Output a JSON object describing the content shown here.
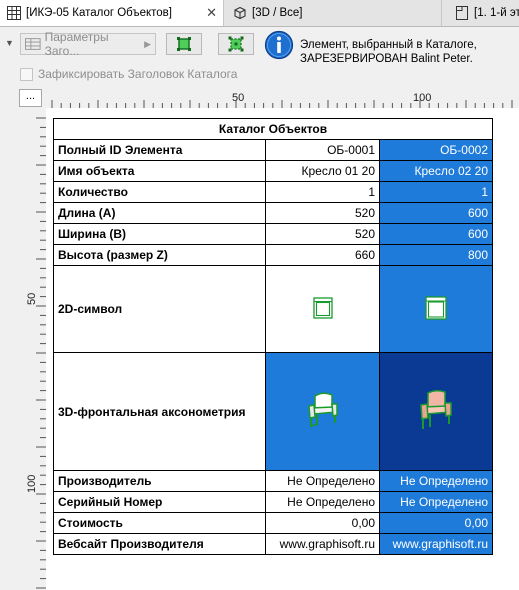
{
  "tabs": [
    {
      "label": "[ИКЭ-05 Каталог Объектов]",
      "active": true,
      "icon": "table-icon"
    },
    {
      "label": "[3D / Все]",
      "icon": "cube-icon"
    },
    {
      "label": "[1. 1-й эт",
      "icon": "floorplan-icon"
    }
  ],
  "toolbar": {
    "params_label": "Параметры Заго...",
    "info_message": "Элемент, выбранный в Каталоге, ЗАРЕЗЕРВИРОВАН Balint Peter.",
    "fix_label": "Зафиксировать Заголовок Каталога",
    "corner_label": "..."
  },
  "ruler": {
    "h_labels": [
      "50",
      "100"
    ],
    "v_labels": [
      "50",
      "100"
    ]
  },
  "catalog": {
    "title": "Каталог Объектов",
    "rows": [
      {
        "label": "Полный ID Элемента",
        "v1": "ОБ-0001",
        "v2": "ОБ-0002"
      },
      {
        "label": "Имя объекта",
        "v1": "Кресло 01 20",
        "v2": "Кресло 02 20"
      },
      {
        "label": "Количество",
        "v1": "1",
        "v2": "1"
      },
      {
        "label": "Длина (А)",
        "v1": "520",
        "v2": "600"
      },
      {
        "label": "Ширина (В)",
        "v1": "520",
        "v2": "600"
      },
      {
        "label": "Высота (размер Z)",
        "v1": "660",
        "v2": "800"
      }
    ],
    "symbol_2d_label": "2D-символ",
    "axon_3d_label": "3D-фронтальная аксонометрия",
    "rows_bottom": [
      {
        "label": "Производитель",
        "v1": "Не Определено",
        "v2": "Не Определено"
      },
      {
        "label": "Серийный Номер",
        "v1": "Не Определено",
        "v2": "Не Определено"
      },
      {
        "label": "Стоимость",
        "v1": "0,00",
        "v2": "0,00"
      },
      {
        "label": "Вебсайт Производителя",
        "v1": "www.graphisoft.ru",
        "v2": "www.graphisoft.ru"
      }
    ]
  },
  "colors": {
    "selected_column": "#1f7bd9",
    "selected_3d_cell": "#0a3a94",
    "symbol_green": "#1a9a2e"
  }
}
